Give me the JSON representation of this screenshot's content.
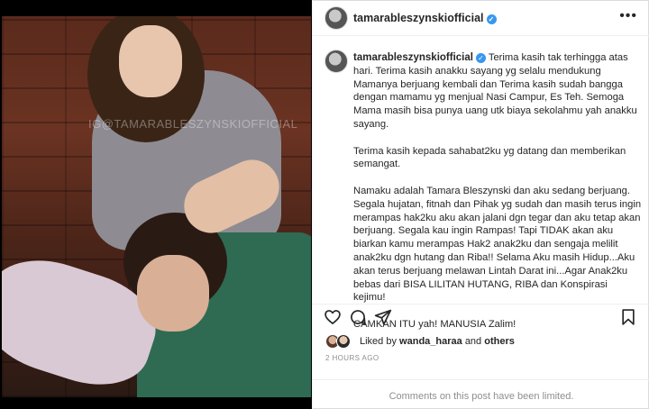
{
  "photo": {
    "watermark": "IG@TAMARABLESZYNSKIOFFICIAL"
  },
  "post": {
    "username": "tamarableszynskiofficial",
    "verified_icon": "verified-badge-icon",
    "more_icon": "more-options-icon",
    "caption": {
      "username": "tamarableszynskiofficial",
      "paragraph_1": "Terima kasih tak terhingga atas hari. Terima kasih anakku sayang yg selalu mendukung Mamanya berjuang kembali dan Terima kasih sudah bangga dengan mamamu yg menjual Nasi Campur, Es Teh. Semoga Mama masih bisa punya uang utk biaya sekolahmu yah anakku sayang.",
      "paragraph_2": "Terima kasih kepada sahabat2ku yg datang dan memberikan semangat.",
      "paragraph_3": "Namaku adalah Tamara Bleszynski dan aku sedang berjuang. Segala hujatan, fitnah dan Pihak yg sudah dan masih terus ingin merampas hak2ku aku akan jalani dgn tegar dan aku tetap akan berjuang. Segala kau ingin Rampas! Tapi TIDAK akan aku biarkan kamu merampas Hak2 anak2ku dan sengaja melilit anak2ku dgn hutang dan Riba!! Selama Aku masih Hidup...Aku akan terus berjuang melawan Lintah Darat ini...Agar Anak2ku bebas dari BISA LILITAN HUTANG, RIBA dan Konspirasi kejimu!",
      "paragraph_4": "CAMKAN ITU yah! MANUSIA Zalim!"
    },
    "actions": {
      "like_icon": "heart-icon",
      "comment_icon": "comment-icon",
      "share_icon": "share-icon",
      "save_icon": "bookmark-icon"
    },
    "likes": {
      "prefix": "Liked by",
      "user": "wanda_haraa",
      "conjunction": "and",
      "others": "others"
    },
    "timestamp": "2 HOURS AGO",
    "comments_notice": "Comments on this post have been limited."
  },
  "colors": {
    "verified": "#3897f0",
    "text": "#262626",
    "muted": "#8e8e8e",
    "border": "#efefef"
  }
}
